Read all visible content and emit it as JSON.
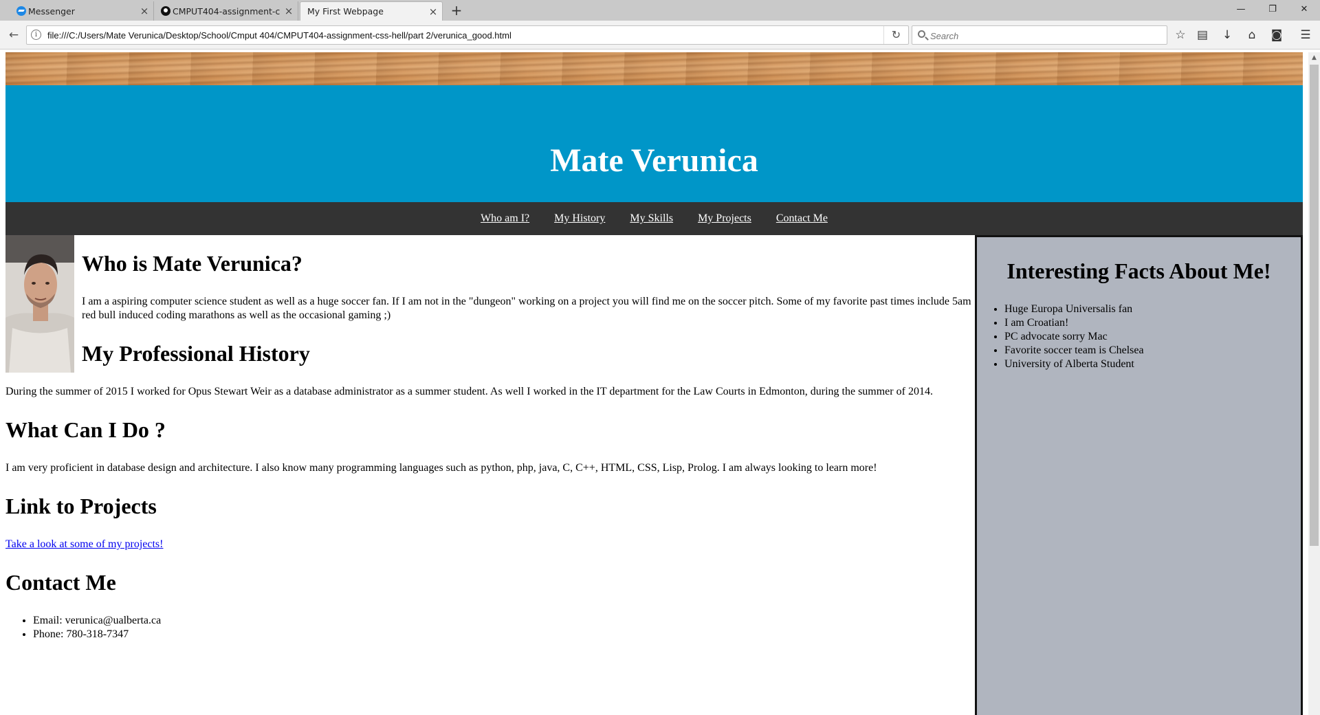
{
  "browser": {
    "tabs": [
      {
        "label": "Messenger",
        "icon": "messenger-icon"
      },
      {
        "label": "CMPUT404-assignment-c...",
        "icon": "github-icon"
      },
      {
        "label": "My First Webpage",
        "icon": ""
      }
    ],
    "close_glyph": "×",
    "new_tab_glyph": "+",
    "window_controls": {
      "minimize": "—",
      "restore": "❐",
      "close": "✕"
    },
    "url": "file:///C:/Users/Mate Verunica/Desktop/School/Cmput 404/CMPUT404-assignment-css-hell/part 2/verunica_good.html",
    "search_placeholder": "Search",
    "nav_glyphs": {
      "back": "←",
      "info": "i",
      "reload": "↻"
    },
    "toolbar_glyphs": {
      "bookmark": "☆",
      "reading_list": "▤",
      "download": "↓",
      "home": "⌂",
      "pocket": "◙",
      "menu": "☰"
    }
  },
  "page": {
    "header_title": "Mate Verunica",
    "nav": [
      "Who am I?",
      "My History",
      "My Skills",
      "My Projects",
      "Contact Me"
    ],
    "who_heading": "Who is Mate Verunica?",
    "who_text": "I am a aspiring computer science student as well as a huge soccer fan. If I am not in the \"dungeon\" working on a project you will find me on the soccer pitch. Some of my favorite past times include 5am red bull induced coding marathons as well as the occasional gaming ;)",
    "history_heading": "My Professional History",
    "history_text": "During the summer of 2015 I worked for Opus Stewart Weir as a database administrator as a summer student. As well I worked in the IT department for the Law Courts in Edmonton, during the summer of 2014.",
    "skills_heading": "What Can I Do ?",
    "skills_text": "I am very proficient in database design and architecture. I also know many programming languages such as python, php, java, C, C++, HTML, CSS, Lisp, Prolog. I am always looking to learn more!",
    "projects_heading": "Link to Projects",
    "projects_link": "Take a look at some of my projects!",
    "contact_heading": "Contact Me",
    "contact_items": [
      "Email: verunica@ualberta.ca",
      "Phone: 780-318-7347"
    ],
    "facts_heading": "Interesting Facts About Me!",
    "facts": [
      "Huge Europa Universalis fan",
      "I am Croatian!",
      "PC advocate sorry Mac",
      "Favorite soccer team is Chelsea",
      "University of Alberta Student"
    ]
  },
  "colors": {
    "banner": "#0096c8",
    "nav_bg": "#333333",
    "aside_bg": "#b0b5bf",
    "link": "#0000ee"
  }
}
